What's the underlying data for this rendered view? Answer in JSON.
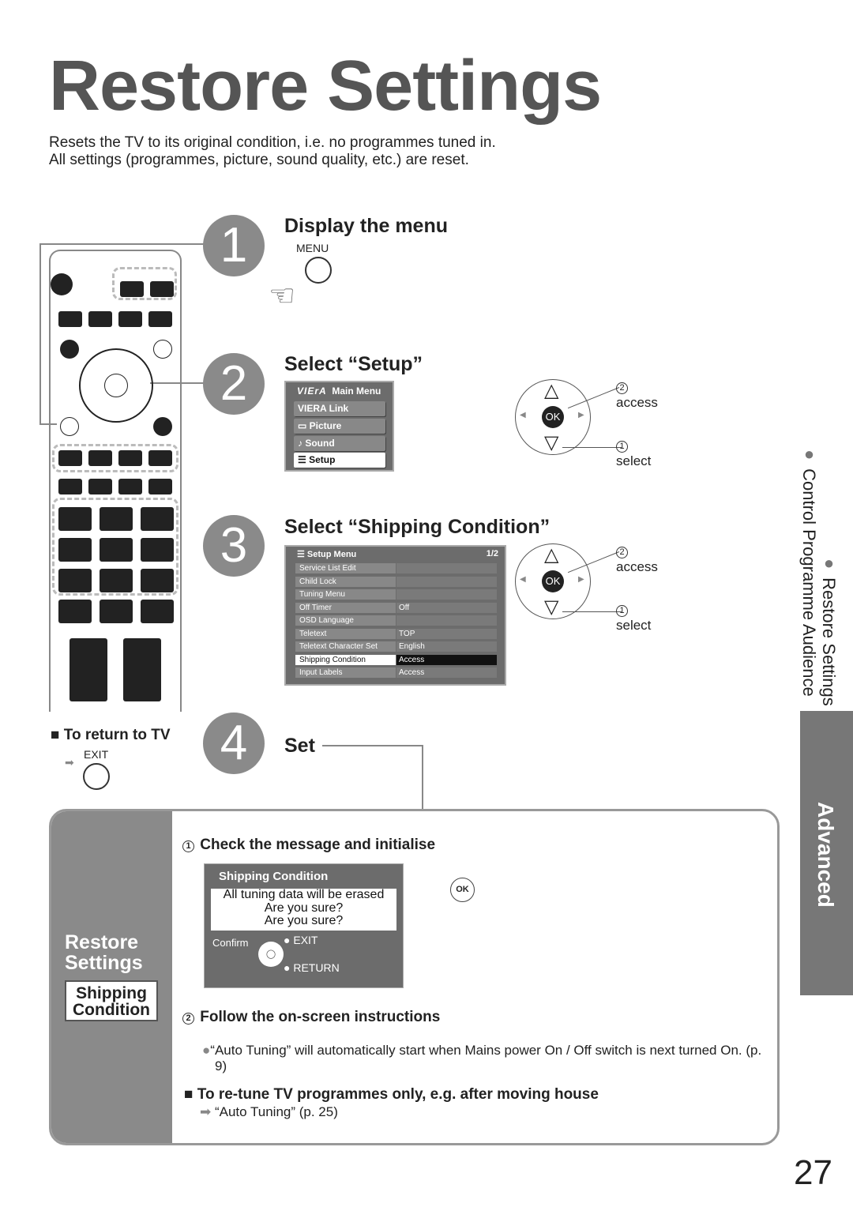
{
  "title": "Restore Settings",
  "intro": [
    "Resets the TV to its original condition, i.e. no programmes tuned in.",
    "All settings (programmes, picture, sound quality, etc.) are reset."
  ],
  "steps": [
    {
      "num": "1",
      "heading": "Display the menu",
      "button": "MENU"
    },
    {
      "num": "2",
      "heading": "Select “Setup”"
    },
    {
      "num": "3",
      "heading": "Select “Shipping Condition”"
    },
    {
      "num": "4",
      "heading": "Set"
    }
  ],
  "main_menu": {
    "logo": "VIErA",
    "title": "Main Menu",
    "items": [
      "VIERA Link",
      "Picture",
      "Sound",
      "Setup"
    ],
    "selected": "Setup"
  },
  "setup_menu": {
    "title": "Setup Menu",
    "page": "1/2",
    "rows": [
      {
        "label": "Service List Edit",
        "value": ""
      },
      {
        "label": "Child Lock",
        "value": ""
      },
      {
        "label": "Tuning Menu",
        "value": ""
      },
      {
        "label": "Off Timer",
        "value": "Off"
      },
      {
        "label": "OSD Language",
        "value": ""
      },
      {
        "label": "Teletext",
        "value": "TOP"
      },
      {
        "label": "Teletext Character Set",
        "value": "English"
      },
      {
        "label": "Shipping Condition",
        "value": "Access"
      },
      {
        "label": "Input Labels",
        "value": "Access"
      }
    ],
    "selected": "Shipping Condition"
  },
  "nav": {
    "ok": "OK",
    "access_num": "2",
    "access": "access",
    "select_num": "1",
    "select": "select"
  },
  "return_tv": {
    "heading": "To return to TV",
    "button": "EXIT"
  },
  "panel": {
    "side_title": "Restore Settings",
    "side_box": "Shipping Condition",
    "step1_num": "1",
    "step1": "Check the message and initialise",
    "dialog": {
      "title": "Shipping Condition",
      "lines": [
        "All tuning data will be erased",
        "Are you sure?",
        "Are you sure?"
      ],
      "confirm": "Confirm",
      "exit": "EXIT",
      "return": "RETURN"
    },
    "ok_button": "OK",
    "step2_num": "2",
    "step2": "Follow the on-screen instructions",
    "note": "“Auto Tuning” will automatically start when Mains power On / Off switch is next turned On. (p. 9)",
    "retune_heading": "To re-tune TV programmes only, e.g. after moving house",
    "retune_ref": "“Auto Tuning” (p. 25)"
  },
  "sidebar": {
    "section1": "Restore Settings",
    "section2": "Control Programme Audience",
    "tab": "Advanced"
  },
  "page_number": "27"
}
